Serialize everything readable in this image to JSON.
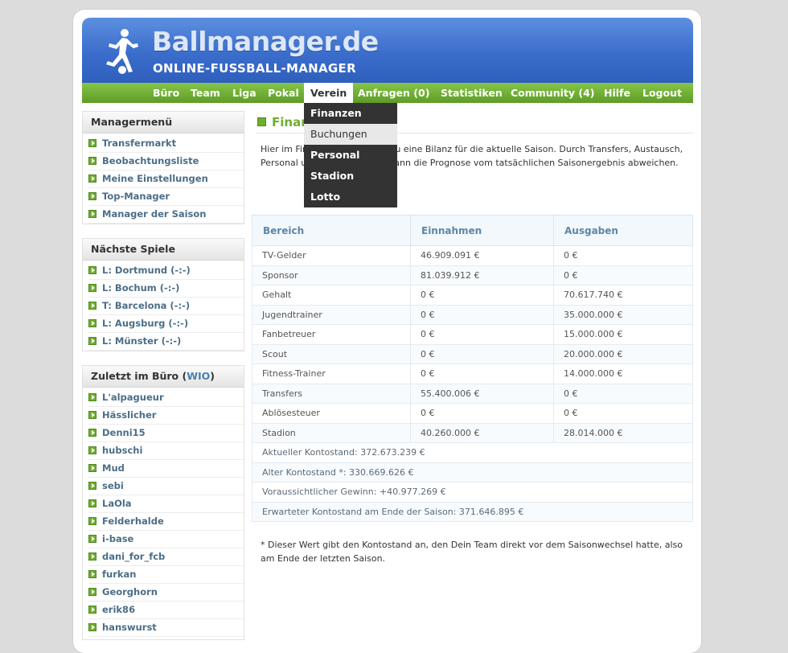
{
  "header": {
    "title": "Ballmanager.de",
    "subtitle": "ONLINE-FUSSBALL-MANAGER"
  },
  "nav": {
    "items": [
      {
        "label": "Büro"
      },
      {
        "label": "Team"
      },
      {
        "label": "Liga"
      },
      {
        "label": "Pokal"
      },
      {
        "label": "Verein",
        "active": true
      },
      {
        "label": "Anfragen (0)"
      },
      {
        "label": "Statistiken"
      },
      {
        "label": "Community (4)"
      },
      {
        "label": "Hilfe"
      },
      {
        "label": "Logout"
      }
    ],
    "dropdown": [
      "Finanzen",
      "Buchungen",
      "Personal",
      "Stadion",
      "Lotto"
    ]
  },
  "sidebar": {
    "managermenu": {
      "title": "Managermenü",
      "items": [
        "Transfermarkt",
        "Beobachtungsliste",
        "Meine Einstellungen",
        "Top-Manager",
        "Manager der Saison"
      ]
    },
    "next_games": {
      "title": "Nächste Spiele",
      "items": [
        "L: Dortmund (-:-)",
        "L: Bochum (-:-)",
        "T: Barcelona (-:-)",
        "L: Augsburg (-:-)",
        "L: Münster (-:-)"
      ]
    },
    "recent": {
      "title_prefix": "Zuletzt im Büro (",
      "title_link": "WIO",
      "title_suffix": ")",
      "items": [
        "L'alpagueur",
        "Hässlicher",
        "Denni15",
        "hubschi",
        "Mud",
        "sebi",
        "LaOla",
        "Felderhalde",
        "i-base",
        "dani_for_fcb",
        "furkan",
        "Georghorn",
        "erik86",
        "hanswurst"
      ]
    }
  },
  "main": {
    "title": "Finanzen",
    "intro": "Hier im Finanzbereich siehst Du eine Bilanz für die aktuelle Saison. Durch Transfers, Austausch, Personal und Stadionausbau kann die Prognose vom tatsächlichen Saisonergebnis abweichen.",
    "table": {
      "headers": [
        "Bereich",
        "Einnahmen",
        "Ausgaben"
      ],
      "rows": [
        [
          "TV-Gelder",
          "46.909.091 €",
          "0 €"
        ],
        [
          "Sponsor",
          "81.039.912 €",
          "0 €"
        ],
        [
          "Gehalt",
          "0 €",
          "70.617.740 €"
        ],
        [
          "Jugendtrainer",
          "0 €",
          "35.000.000 €"
        ],
        [
          "Fanbetreuer",
          "0 €",
          "15.000.000 €"
        ],
        [
          "Scout",
          "0 €",
          "20.000.000 €"
        ],
        [
          "Fitness-Trainer",
          "0 €",
          "14.000.000 €"
        ],
        [
          "Transfers",
          "55.400.006 €",
          "0 €"
        ],
        [
          "Ablösesteuer",
          "0 €",
          "0 €"
        ],
        [
          "Stadion",
          "40.260.000 €",
          "28.014.000 €"
        ]
      ],
      "summary": [
        "Aktueller Kontostand: 372.673.239 €",
        "Alter Kontostand *: 330.669.626 €",
        "Voraussichtlicher Gewinn: +40.977.269 €",
        "Erwarteter Kontostand am Ende der Saison: 371.646.895 €"
      ]
    },
    "footnote": "* Dieser Wert gibt den Kontostand an, den Dein Team direkt vor dem Saisonwechsel hatte, also am Ende der letzten Saison."
  }
}
